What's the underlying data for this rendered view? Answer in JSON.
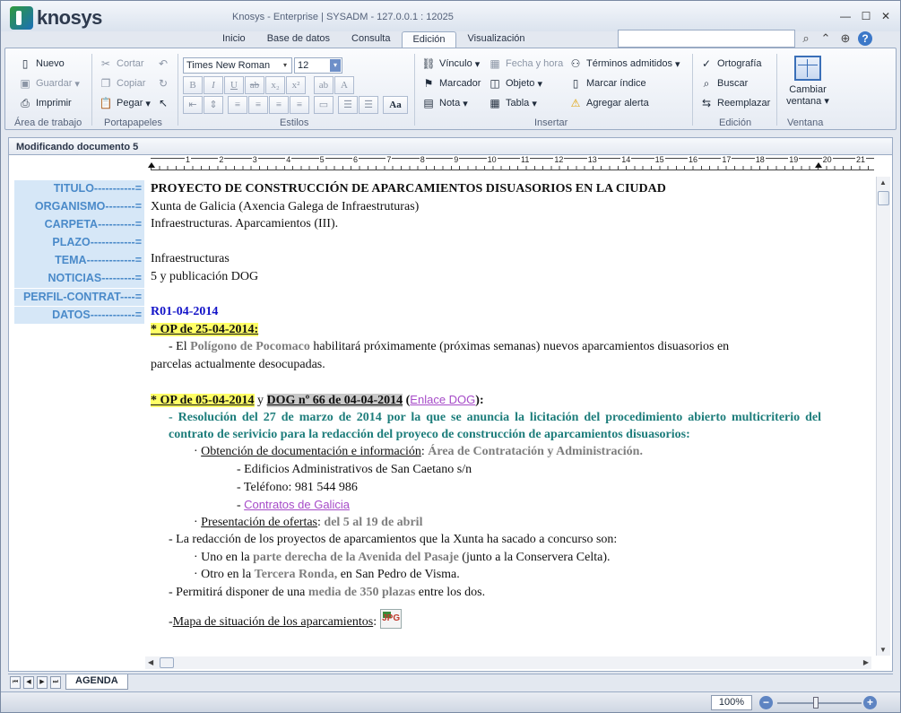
{
  "app": {
    "logo_text": "knosys",
    "window_title": "Knosys - Enterprise   |   SYSADM - 127.0.0.1 : 12025"
  },
  "tabs": [
    {
      "label": "Inicio",
      "active": false
    },
    {
      "label": "Base de datos",
      "active": false
    },
    {
      "label": "Consulta",
      "active": false
    },
    {
      "label": "Edición",
      "active": true
    },
    {
      "label": "Visualización",
      "active": false
    }
  ],
  "ribbon": {
    "workspace": {
      "new": "Nuevo",
      "save": "Guardar",
      "print": "Imprimir",
      "label": "Área de trabajo"
    },
    "clipboard": {
      "cut": "Cortar",
      "copy": "Copiar",
      "paste": "Pegar",
      "label": "Portapapeles"
    },
    "styles": {
      "font": "Times New Roman",
      "size": "12",
      "label": "Estilos",
      "case_btn": "Aa"
    },
    "insert": {
      "link": "Vínculo",
      "date": "Fecha y hora",
      "terms": "Términos admitidos",
      "bookmark": "Marcador",
      "object": "Objeto",
      "index": "Marcar índice",
      "note": "Nota",
      "table": "Tabla",
      "alert": "Agregar alerta",
      "label": "Insertar"
    },
    "edit": {
      "spelling": "Ortografía",
      "find": "Buscar",
      "replace": "Reemplazar",
      "label": "Edición"
    },
    "window": {
      "change": "Cambiar",
      "window": "ventana",
      "label": "Ventana"
    }
  },
  "document": {
    "header": "Modificando documento 5",
    "ruler_numbers": [
      "1",
      "2",
      "3",
      "4",
      "5",
      "6",
      "7",
      "8",
      "9",
      "10",
      "11",
      "12",
      "13",
      "14",
      "15",
      "16",
      "17",
      "18",
      "19",
      "20",
      "21"
    ],
    "fields": [
      "TITULO-----------=",
      "ORGANISMO--------=",
      "CARPETA----------=",
      "PLAZO------------=",
      "TEMA-------------=",
      "NOTICIAS---------=",
      "PERFIL-CONTRAT----=",
      "DATOS------------="
    ],
    "title": "PROYECTO DE CONSTRUCCIÓN DE APARCAMIENTOS DISUASORIOS  EN LA CIUDAD",
    "organism": "Xunta de Galicia (Axencia Galega de Infraestruturas)",
    "folder": "Infraestructuras. Aparcamientos (III).",
    "theme": "Infraestructuras",
    "news": "5 y publicación DOG",
    "ref": "R01-04-2014",
    "op1": "* OP de 25-04-2014:",
    "op1_text_a": "- El ",
    "op1_text_b": "Polígono de Pocomaco",
    "op1_text_c": " habilitará próximamente (próximas semanas) nuevos aparcamientos disuasorios en",
    "op1_text_d": "parcelas actualmente desocupadas.",
    "op2": "* OP de 05-04-2014",
    "op2_y": " y ",
    "dog": "DOG nº 66 de 04-04-2014",
    "dog_open": " (",
    "dog_link": "Enlace DOG",
    "dog_close": "):",
    "resolution": "- Resolución del 27 de marzo de 2014 por la que se anuncia la licitación del procedimiento abierto multicriterio del contrato de serivicio para la redacción del proyeco de construcción de aparcamientos disuasorios:",
    "obtain_label": "Obtención de documentación e información",
    "obtain_colon": ": ",
    "obtain_value": "Área de Contratación y Administración.",
    "addr": "- Edificios Administrativos de San Caetano s/n",
    "phone": "- Teléfono: 981 544 986",
    "contracts_dash": "- ",
    "contracts_link": "Contratos de Galicia",
    "offers_label": "Presentación de ofertas",
    "offers_colon": ": ",
    "offers_value": "del 5 al 19 de abril",
    "projects": "- La redacción de los proyectos de aparcamientos que la Xunta ha sacado a concurso son:",
    "proj1_a": "Uno en la ",
    "proj1_b": "parte derecha de la Avenida del Pasaje",
    "proj1_c": " (junto a la Conservera Celta).",
    "proj2_a": "Otro en la ",
    "proj2_b": "Tercera Ronda,",
    "proj2_c": " en San Pedro de Visma.",
    "capacity_a": "- Permitirá disponer de una ",
    "capacity_b": "media de 350 plazas",
    "capacity_c": " entre los dos.",
    "map_dash": "-",
    "map_label": "Mapa de situación de los aparcamientos",
    "map_colon": ":",
    "jpg": "JPG"
  },
  "sheet_tab": "AGENDA",
  "status": {
    "zoom": "100%"
  }
}
